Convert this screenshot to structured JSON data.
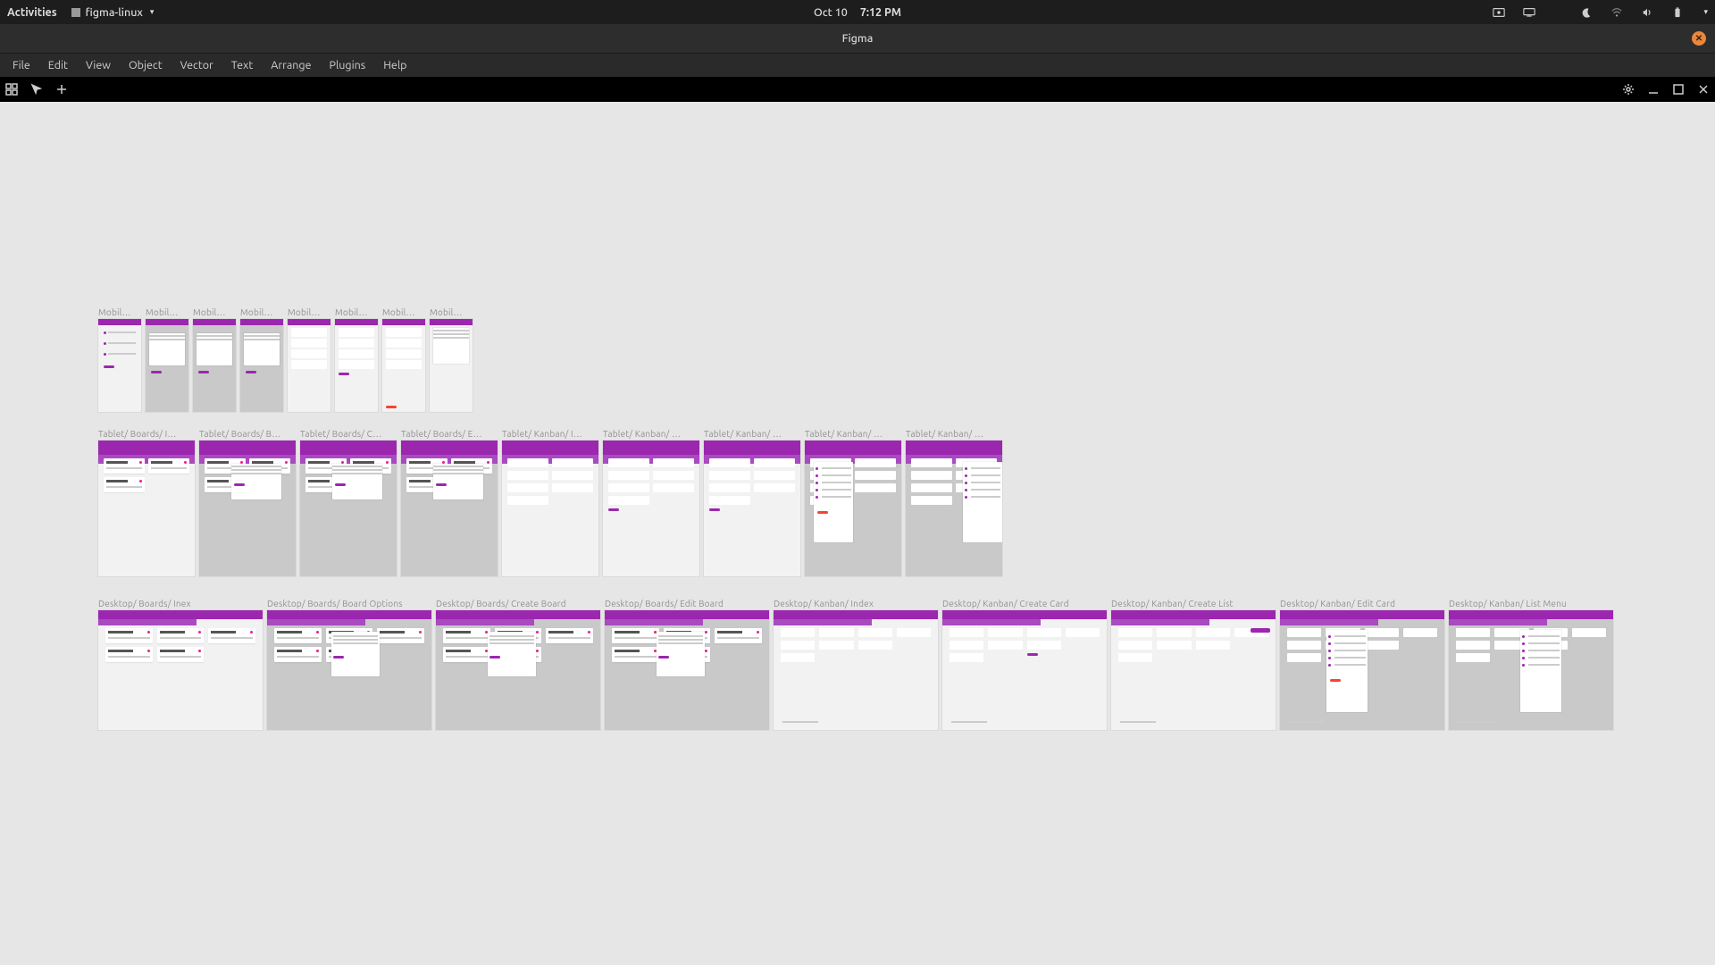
{
  "gnome": {
    "activities": "Activities",
    "app_name": "figma-linux",
    "date": "Oct 10",
    "time": "7:12 PM"
  },
  "window": {
    "title": "Figma"
  },
  "menus": [
    "File",
    "Edit",
    "View",
    "Object",
    "Vector",
    "Text",
    "Arrange",
    "Plugins",
    "Help"
  ],
  "accent": "#9b27af",
  "accent_pink": "#e91f8f",
  "canvas_bg": "#e6e6e6",
  "rows": {
    "mobile": {
      "label_prefix": "Mobil…",
      "frames": [
        {
          "label": "Mobil…",
          "bg": "light"
        },
        {
          "label": "Mobil…",
          "bg": "grey"
        },
        {
          "label": "Mobil…",
          "bg": "grey"
        },
        {
          "label": "Mobil…",
          "bg": "grey"
        },
        {
          "label": "Mobil…",
          "bg": "light"
        },
        {
          "label": "Mobil…",
          "bg": "light"
        },
        {
          "label": "Mobil…",
          "bg": "light"
        },
        {
          "label": "Mobil…",
          "bg": "light"
        }
      ]
    },
    "tablet": {
      "frames": [
        {
          "label": "Tablet/ Boards/ I…",
          "bg": "light"
        },
        {
          "label": "Tablet/ Boards/ B…",
          "bg": "grey"
        },
        {
          "label": "Tablet/ Boards/ C…",
          "bg": "grey"
        },
        {
          "label": "Tablet/ Boards/ E…",
          "bg": "grey"
        },
        {
          "label": "Tablet/ Kanban/ I…",
          "bg": "light"
        },
        {
          "label": "Tablet/ Kanban/ …",
          "bg": "light"
        },
        {
          "label": "Tablet/ Kanban/ …",
          "bg": "light"
        },
        {
          "label": "Tablet/ Kanban/ …",
          "bg": "grey"
        },
        {
          "label": "Tablet/ Kanban/ …",
          "bg": "grey"
        }
      ]
    },
    "desktop": {
      "frames": [
        {
          "label": "Desktop/ Boards/ Inex",
          "bg": "light"
        },
        {
          "label": "Desktop/ Boards/ Board Options",
          "bg": "grey"
        },
        {
          "label": "Desktop/ Boards/ Create Board",
          "bg": "grey"
        },
        {
          "label": "Desktop/ Boards/ Edit Board",
          "bg": "grey"
        },
        {
          "label": "Desktop/ Kanban/ Index",
          "bg": "light"
        },
        {
          "label": "Desktop/ Kanban/ Create Card",
          "bg": "light"
        },
        {
          "label": "Desktop/ Kanban/ Create List",
          "bg": "light"
        },
        {
          "label": "Desktop/ Kanban/ Edit Card",
          "bg": "grey"
        },
        {
          "label": "Desktop/ Kanban/ List Menu",
          "bg": "grey"
        }
      ]
    }
  }
}
